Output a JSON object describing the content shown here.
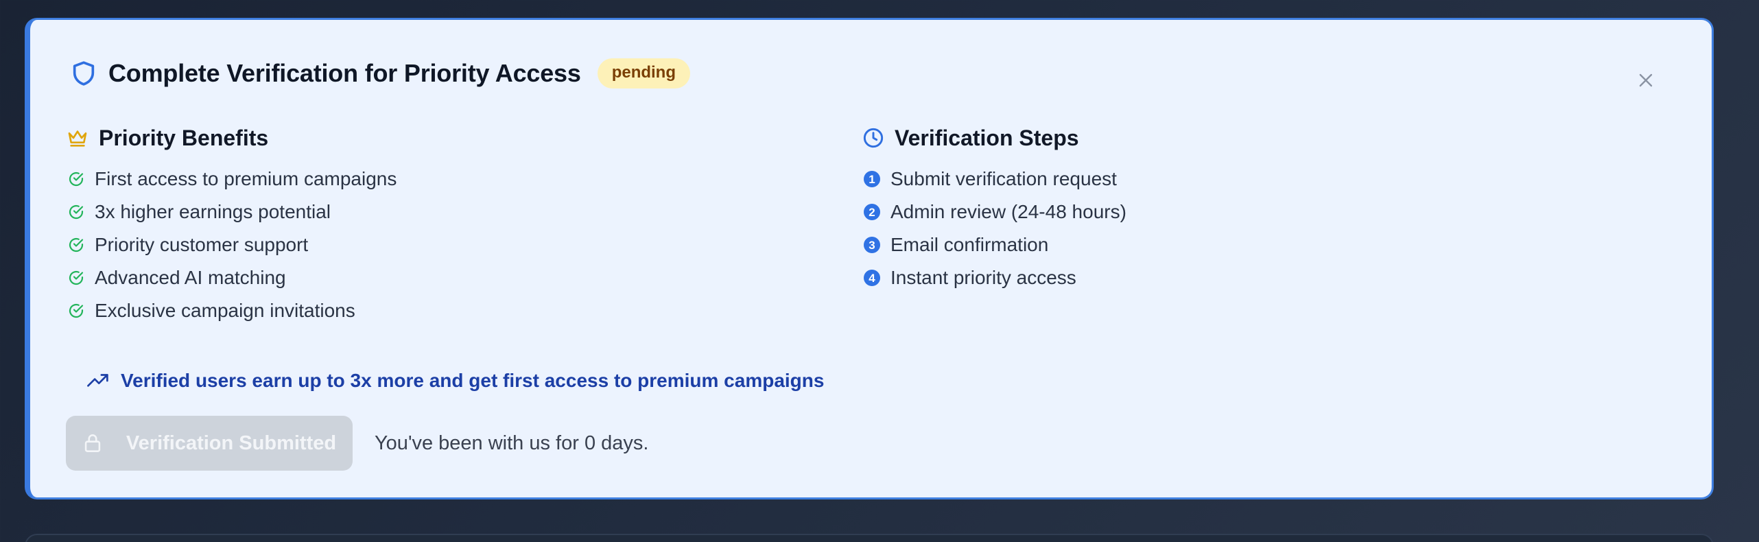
{
  "card": {
    "title": "Complete Verification for Priority Access",
    "status_badge": "pending",
    "icons": {
      "header": "shield-icon",
      "close": "close-icon"
    }
  },
  "benefits": {
    "heading": "Priority Benefits",
    "heading_icon": "crown-icon",
    "item_icon": "check-circle-icon",
    "items": [
      "First access to premium campaigns",
      "3x higher earnings potential",
      "Priority customer support",
      "Advanced AI matching",
      "Exclusive campaign invitations"
    ]
  },
  "steps": {
    "heading": "Verification Steps",
    "heading_icon": "clock-icon",
    "items": [
      {
        "number": "1",
        "label": "Submit verification request"
      },
      {
        "number": "2",
        "label": "Admin review (24-48 hours)"
      },
      {
        "number": "3",
        "label": "Email confirmation"
      },
      {
        "number": "4",
        "label": "Instant priority access"
      }
    ]
  },
  "promo": {
    "icon": "trending-up-icon",
    "text": "Verified users earn up to 3x more and get first access to premium campaigns"
  },
  "footer": {
    "button_label": "Verification Submitted",
    "button_icon": "lock-icon",
    "button_disabled": true,
    "tenure_text": "You've been with us for 0 days."
  },
  "colors": {
    "accent": "#3a7ae0",
    "card_background": "#ecf3fe",
    "badge_background": "#fdf1b8",
    "badge_text": "#7a3f05",
    "success": "#22b45a",
    "crown": "#e0a50b",
    "promo_text": "#1c3fa6",
    "disabled_button": "#cdd3db"
  }
}
